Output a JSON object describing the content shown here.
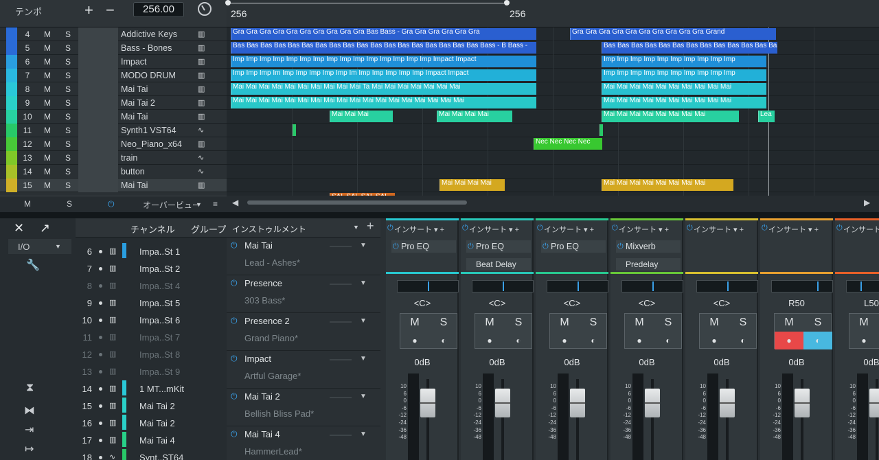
{
  "header": {
    "tempo_label": "テンポ",
    "tempo_value": "256.00",
    "plus": "+",
    "minus": "−"
  },
  "ruler": {
    "mark_a": "256",
    "mark_b": "256"
  },
  "tracks": [
    {
      "num": "4",
      "m": "M",
      "s": "S",
      "name": "Addictive Keys",
      "icon": "piano-icon",
      "color": "#2a6bd8"
    },
    {
      "num": "5",
      "m": "M",
      "s": "S",
      "name": "Bass - Bones",
      "icon": "piano-icon",
      "color": "#2a6bd8"
    },
    {
      "num": "6",
      "m": "M",
      "s": "S",
      "name": "Impact",
      "icon": "piano-icon",
      "color": "#2a9ee0"
    },
    {
      "num": "7",
      "m": "M",
      "s": "S",
      "name": "MODO DRUM",
      "icon": "piano-icon",
      "color": "#2ab8e0"
    },
    {
      "num": "8",
      "m": "M",
      "s": "S",
      "name": "Mai Tai",
      "icon": "piano-icon",
      "color": "#2ac8d8"
    },
    {
      "num": "9",
      "m": "M",
      "s": "S",
      "name": "Mai Tai 2",
      "icon": "piano-icon",
      "color": "#2ad0c8"
    },
    {
      "num": "10",
      "m": "M",
      "s": "S",
      "name": "Mai Tai",
      "icon": "piano-icon",
      "color": "#28d0a0"
    },
    {
      "num": "11",
      "m": "M",
      "s": "S",
      "name": "Synth1 VST64",
      "icon": "wave-icon",
      "color": "#28c868"
    },
    {
      "num": "12",
      "m": "M",
      "s": "S",
      "name": "Neo_Piano_x64",
      "icon": "piano-icon",
      "color": "#48c838"
    },
    {
      "num": "13",
      "m": "M",
      "s": "S",
      "name": "train",
      "icon": "wave-icon",
      "color": "#80c828"
    },
    {
      "num": "14",
      "m": "M",
      "s": "S",
      "name": "button",
      "icon": "wave-icon",
      "color": "#a8c028"
    },
    {
      "num": "15",
      "m": "M",
      "s": "S",
      "name": "Mai Tai",
      "icon": "piano-icon",
      "color": "#d0b028"
    }
  ],
  "track_footer": {
    "m": "M",
    "s": "S",
    "overview": "オーバービュー"
  },
  "arrange_clips": {
    "row0": "Gra Gra Gra Gra  Gra Gra Gra Gra Gra Gra Bas Bass -  Gra Gra Gra Gra Gra Gra",
    "row0b": "Gra Gra  Gra Gra Gra Gra Gra Gra Gra Gra Grand",
    "row1": "Bas Bas Bas Bas  Bas Bas Bas Bas Bas Bas Bas Bas Bas Bas Bas Bas Bas Bas Bass - B Bass -",
    "row1b": "Bas Bas Bas Bas Bas Bas Bas Bas Bas Bas Bas Bas Bass -",
    "row2": "Imp Imp Imp Imp  Imp Imp Imp Imp Imp Imp Imp Imp Imp Imp Imp Impact  Impact",
    "row2b": "Imp Imp Imp Imp Imp Imp Imp Imp Imp Imp",
    "row3": "Imp Imp Imp Im   Imp Imp Imp Imp Imp Im Imp Imp Imp Imp Imp Impact Impact",
    "row3b": "Imp Imp Imp Imp Imp Imp Imp Imp Imp Imp",
    "row4": "Mai Mai Mai Mai  Mai Mai Mai Mai Mai Mai Ta Mai Mai Mai Mai Mai   Mai Mai",
    "row4b": "Mai Mai Mai Mai Mai Mai Mai Mai Mai Mai",
    "row5": "Mai Mai Mai Mai  Mai Mai Mai Mai Mai Mai Mai Mai Mai Mai Mai Mai   Mai Mai",
    "row5b": "Mai Mai Mai Mai Mai Mai Mai Mai Mai Mai",
    "row6a": "Mai Mai Mai",
    "row6b": "Mai Mai Mai Mai",
    "row6c": "Mai Mai Mai Mai Mai Mai Mai Mai",
    "row6d": "Lea",
    "row8": "Nec Nec Nec Nec",
    "row11a": "Mai Mai Mai Mai",
    "row11b": "Mai Mai Mai Mai Mai Mai Mai Mai",
    "row12": "SAL SAL SAL SAL"
  },
  "bottom_left": {
    "close": "✕",
    "io": "I/O"
  },
  "channel_header": {
    "channel": "チャンネル",
    "group": "グループ"
  },
  "channels": [
    {
      "num": "6",
      "name": "Impa..St 1",
      "dim": false,
      "color": "#2a9ee0",
      "kind": "piano-icon"
    },
    {
      "num": "7",
      "name": "Impa..St 2",
      "dim": false,
      "color": "",
      "kind": "piano-icon"
    },
    {
      "num": "8",
      "name": "Impa..St 4",
      "dim": true,
      "color": "",
      "kind": "piano-icon"
    },
    {
      "num": "9",
      "name": "Impa..St 5",
      "dim": false,
      "color": "",
      "kind": "piano-icon"
    },
    {
      "num": "10",
      "name": "Impa..St 6",
      "dim": false,
      "color": "",
      "kind": "piano-icon"
    },
    {
      "num": "11",
      "name": "Impa..St 7",
      "dim": true,
      "color": "",
      "kind": "piano-icon"
    },
    {
      "num": "12",
      "name": "Impa..St 8",
      "dim": true,
      "color": "",
      "kind": "piano-icon"
    },
    {
      "num": "13",
      "name": "Impa..St 9",
      "dim": true,
      "color": "",
      "kind": "piano-icon"
    },
    {
      "num": "14",
      "name": "1 MT...mKit",
      "dim": false,
      "color": "#2ac8d8",
      "kind": "piano-icon"
    },
    {
      "num": "15",
      "name": "Mai Tai 2",
      "dim": false,
      "color": "#2ad0c8",
      "kind": "piano-icon"
    },
    {
      "num": "16",
      "name": "Mai Tai 2",
      "dim": false,
      "color": "#2ad0c8",
      "kind": "piano-icon"
    },
    {
      "num": "17",
      "name": "Mai Tai 4",
      "dim": false,
      "color": "#28d088",
      "kind": "piano-icon"
    },
    {
      "num": "18",
      "name": "Synt..ST64",
      "dim": false,
      "color": "#28c868",
      "kind": "wave-icon"
    }
  ],
  "instruments_header": {
    "title": "インストゥルメント"
  },
  "instruments": [
    {
      "name": "Mai Tai",
      "preset": "Lead - Ashes*"
    },
    {
      "name": "Presence",
      "preset": "303 Bass*"
    },
    {
      "name": "Presence 2",
      "preset": "Grand Piano*"
    },
    {
      "name": "Impact",
      "preset": "Artful Garage*"
    },
    {
      "name": "Mai Tai 2",
      "preset": "Bellish Bliss Pad*"
    },
    {
      "name": "Mai Tai 4",
      "preset": "HammerLead*"
    }
  ],
  "mixer": {
    "insert_label": "インサート",
    "scale": [
      "10",
      "6",
      "0",
      "-6",
      "-12",
      "-24",
      "-36",
      "-48"
    ],
    "strips": [
      {
        "color": "#28c8d0",
        "slot1": "Pro EQ",
        "slot2": "",
        "pan": "<C>",
        "db": "0dB",
        "m": "M",
        "s": "S",
        "active": false
      },
      {
        "color": "#28c8b8",
        "slot1": "Pro EQ",
        "slot2": "Beat Delay",
        "pan": "<C>",
        "db": "0dB",
        "m": "M",
        "s": "S",
        "active": false
      },
      {
        "color": "#28c890",
        "slot1": "Pro EQ",
        "slot2": "",
        "pan": "<C>",
        "db": "0dB",
        "m": "M",
        "s": "S",
        "active": false
      },
      {
        "color": "#68c838",
        "slot1": "Mixverb",
        "slot2": "Predelay",
        "pan": "<C>",
        "db": "0dB",
        "m": "M",
        "s": "S",
        "active": false
      },
      {
        "color": "#d8c030",
        "slot1": "",
        "slot2": "",
        "pan": "<C>",
        "db": "0dB",
        "m": "M",
        "s": "S",
        "active": false
      },
      {
        "color": "#e8a030",
        "slot1": "",
        "slot2": "",
        "pan": "R50",
        "db": "0dB",
        "m": "M",
        "s": "S",
        "active": true
      },
      {
        "color": "#e86028",
        "slot1": "",
        "slot2": "",
        "pan": "L50",
        "db": "0dB",
        "m": "M",
        "s": "S",
        "active": false
      }
    ]
  }
}
